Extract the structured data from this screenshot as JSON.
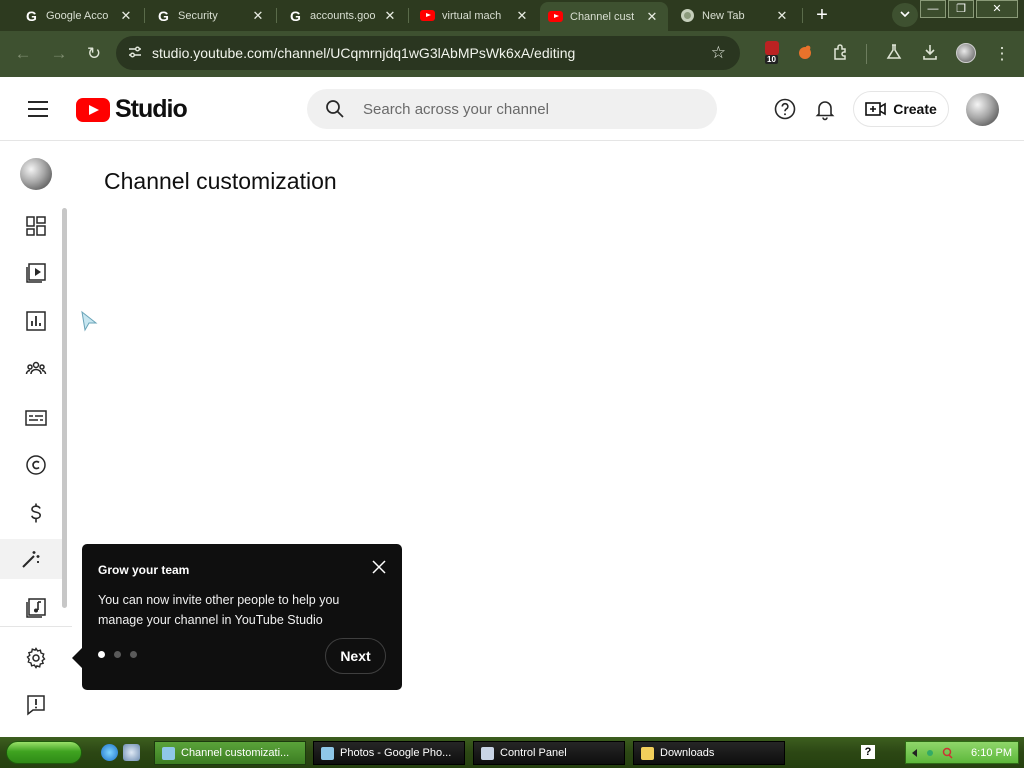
{
  "browser": {
    "tabs": [
      {
        "label": "Google Acco",
        "icon": "google-icon"
      },
      {
        "label": "Security",
        "icon": "google-icon"
      },
      {
        "label": "accounts.goo",
        "icon": "google-icon"
      },
      {
        "label": "virtual mach",
        "icon": "youtube-icon"
      },
      {
        "label": "Channel cust",
        "icon": "youtube-icon",
        "active": true
      },
      {
        "label": "New Tab",
        "icon": "chrome-icon"
      }
    ],
    "url": "studio.youtube.com/channel/UCqmrnjdq1wG3lAbMPsWk6xA/editing",
    "extension_badge": "10",
    "window_buttons": {
      "minimize": "—",
      "restore": "❐",
      "close": "✕"
    }
  },
  "header": {
    "logo_text": "Studio",
    "search_placeholder": "Search across your channel",
    "create_label": "Create"
  },
  "main": {
    "title": "Channel customization"
  },
  "tooltip": {
    "title": "Grow your team",
    "body": "You can now invite other people to help you manage your channel in YouTube Studio",
    "next_label": "Next",
    "page_index": 1,
    "page_count": 3
  },
  "taskbar": {
    "tasks": [
      {
        "label": "Channel customizati...",
        "active": true
      },
      {
        "label": "Photos - Google Pho...",
        "active": false
      },
      {
        "label": "Control Panel",
        "active": false
      },
      {
        "label": "Downloads",
        "active": false
      }
    ],
    "clock": "6:10 PM"
  },
  "colors": {
    "browser_frame": "#2d3a1f",
    "toolbar": "#3e5130",
    "youtube_red": "#ff0000",
    "tooltip_bg": "#0f0f0f",
    "taskbar": "#2c4714"
  }
}
